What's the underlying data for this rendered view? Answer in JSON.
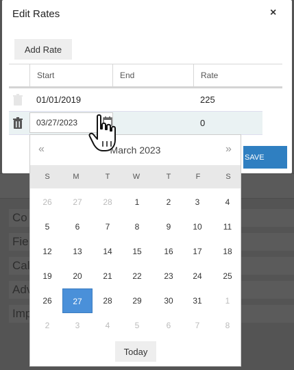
{
  "modal": {
    "title": "Edit Rates",
    "close_label": "×",
    "add_rate_label": "Add Rate",
    "save_label": "SAVE"
  },
  "grid": {
    "columns": [
      "Start",
      "End",
      "Rate"
    ],
    "rows": [
      {
        "start": "01/01/2019",
        "end": "",
        "rate": "225"
      },
      {
        "start": "03/27/2023",
        "end": "",
        "rate": "0"
      }
    ]
  },
  "datepicker": {
    "title": "March 2023",
    "prev_label": "«",
    "next_label": "»",
    "weekdays": [
      "S",
      "M",
      "T",
      "W",
      "T",
      "F",
      "S"
    ],
    "weeks": [
      [
        "26",
        "27",
        "28",
        "1",
        "2",
        "3",
        "4"
      ],
      [
        "5",
        "6",
        "7",
        "8",
        "9",
        "10",
        "11"
      ],
      [
        "12",
        "13",
        "14",
        "15",
        "16",
        "17",
        "18"
      ],
      [
        "19",
        "20",
        "21",
        "22",
        "23",
        "24",
        "25"
      ],
      [
        "26",
        "27",
        "28",
        "29",
        "30",
        "31",
        "1"
      ],
      [
        "2",
        "3",
        "4",
        "5",
        "6",
        "7",
        "8"
      ]
    ],
    "selected_day": "27",
    "today_label": "Today"
  },
  "background": {
    "row_labels": [
      "Co",
      "Fie",
      "Cal",
      "Adv",
      "Imp"
    ]
  }
}
